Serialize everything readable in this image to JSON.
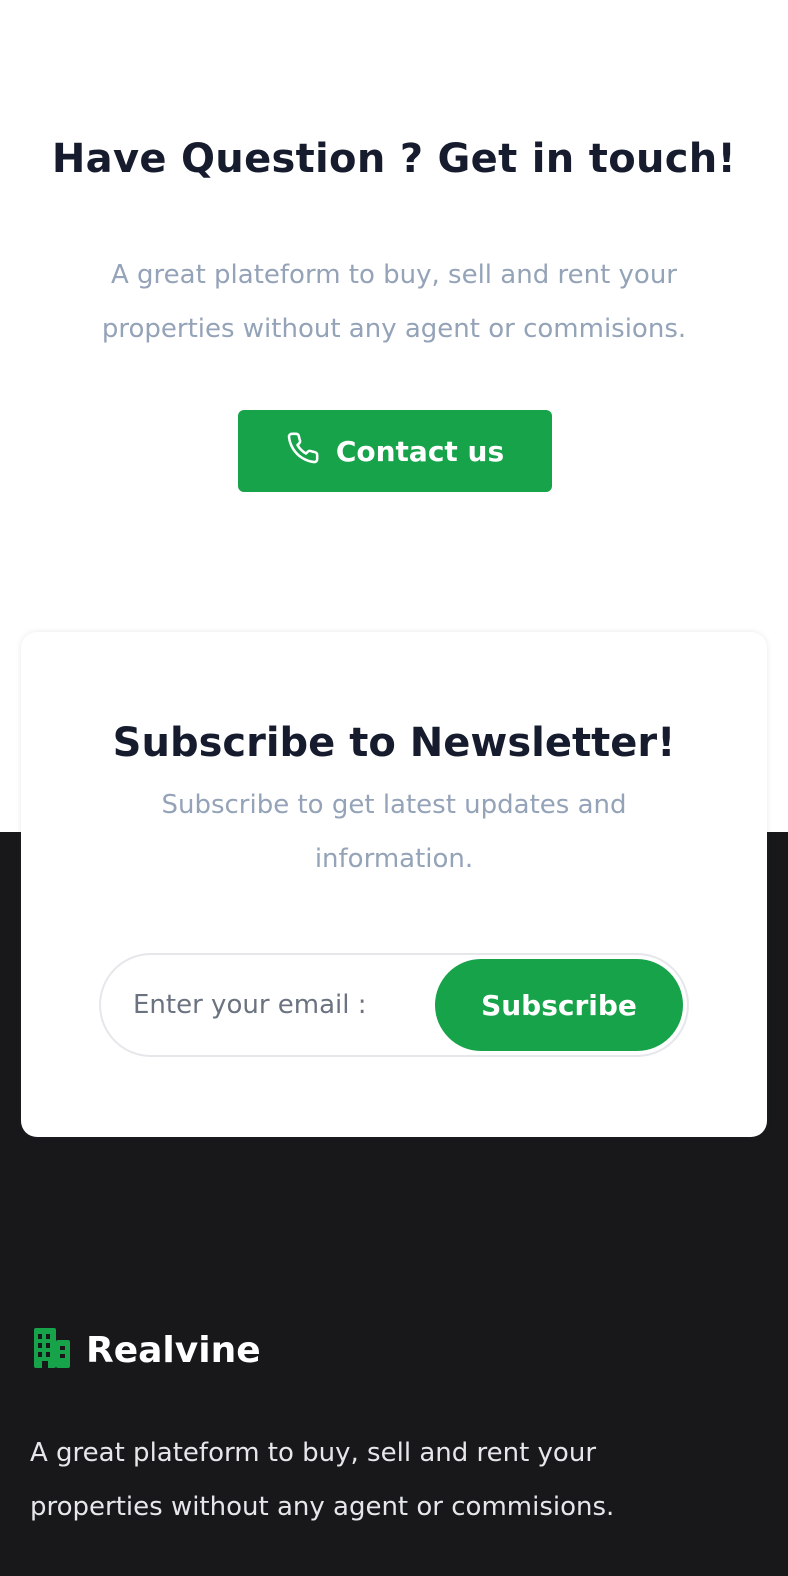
{
  "contact": {
    "title": "Have Question ? Get in touch!",
    "description": "A great plateform to buy, sell and rent your properties without any agent or commisions.",
    "button_label": "Contact us",
    "button_icon": "phone-icon"
  },
  "newsletter": {
    "title": "Subscribe to Newsletter!",
    "description": "Subscribe to get latest updates and information.",
    "email_placeholder": "Enter your email :",
    "email_value": "",
    "subscribe_label": "Subscribe"
  },
  "footer": {
    "brand_name": "Realvine",
    "brand_icon": "building-icon",
    "description": "A great plateform to buy, sell and rent your properties without any agent or commisions."
  },
  "colors": {
    "accent": "#16a34a",
    "heading": "#161c2d",
    "muted_text": "#94a3b8",
    "footer_bg": "#18181b",
    "white": "#ffffff"
  }
}
